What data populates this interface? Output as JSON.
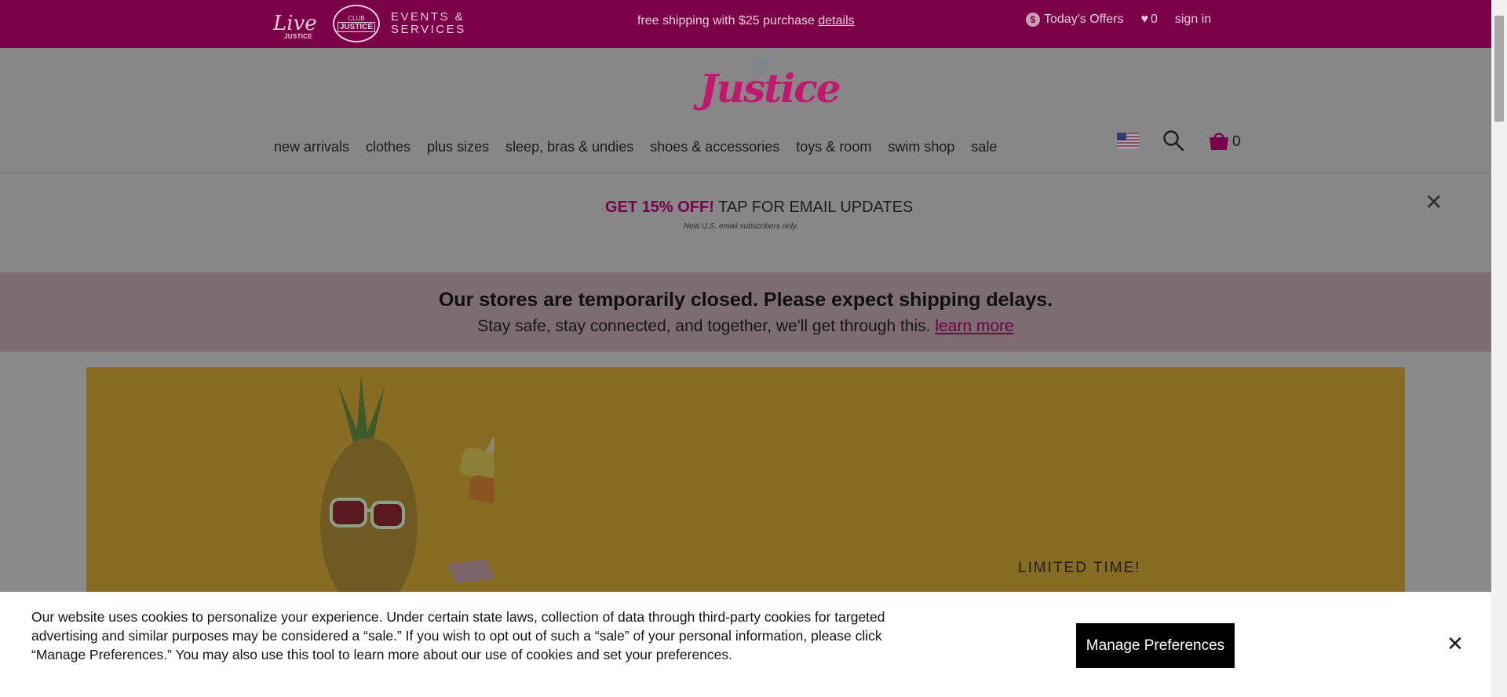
{
  "topbar": {
    "live_logo": "Live",
    "live_logo_sub": "JUSTICE",
    "club_logo_top": "CLUB",
    "club_logo_main": "JUSTICE",
    "events_line1": "EVENTS &",
    "events_line2": "SERVICES",
    "shipping_text": "free shipping with $25 purchase",
    "shipping_link": "details",
    "offers_icon": "$",
    "offers_label": "Today's Offers",
    "wishlist_count": "0",
    "signin_label": "sign in"
  },
  "header": {
    "logo_text": "Justice",
    "nav": [
      "new arrivals",
      "clothes",
      "plus sizes",
      "sleep, bras & undies",
      "shoes & accessories",
      "toys & room",
      "swim shop",
      "sale"
    ],
    "cart_count": "0"
  },
  "email_signup": {
    "highlight": "GET 15% OFF!",
    "text": "TAP FOR EMAIL UPDATES",
    "fine_print": "New U.S. email subscribers only.",
    "close_symbol": "✕"
  },
  "store_notice": {
    "title": "Our stores are temporarily closed. Please expect shipping delays.",
    "subtitle": "Stay safe, stay connected, and together, we'll get through this.",
    "link": "learn more"
  },
  "hero": {
    "limited_text": "LIMITED TIME!"
  },
  "cookie_banner": {
    "text": "Our website uses cookies to personalize your experience. Under certain state laws, collection of data through third-party cookies for targeted advertising and similar purposes may be considered a “sale.” If you wish to opt out of such a “sale” of your personal information, please click “Manage Preferences.” You may also use this tool to learn more about our use of cookies and set your preferences.",
    "manage_label": "Manage Preferences",
    "close_symbol": "✕"
  },
  "colors": {
    "brand_primary": "#7a0048",
    "brand_pink": "#c4166f",
    "hero_bg": "#876c22"
  }
}
